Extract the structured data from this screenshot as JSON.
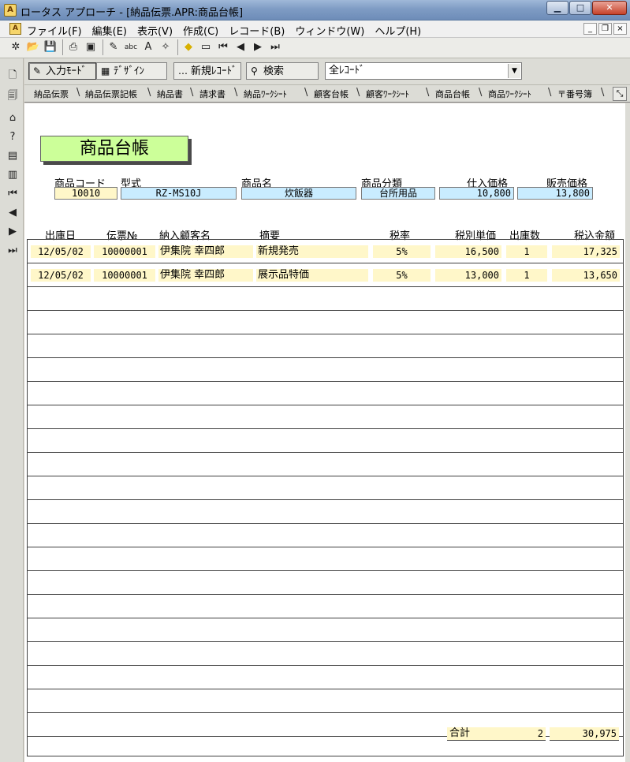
{
  "window": {
    "title": "ロータス アプローチ - [納品伝票.APR:商品台帳]",
    "app_icon": "lotus-approach-icon",
    "minimize": "▁",
    "maximize": "□",
    "close": "✕"
  },
  "menu": {
    "items": [
      {
        "label": "ファイル(F)"
      },
      {
        "label": "編集(E)"
      },
      {
        "label": "表示(V)"
      },
      {
        "label": "作成(C)"
      },
      {
        "label": "レコード(B)"
      },
      {
        "label": "ウィンドウ(W)"
      },
      {
        "label": "ヘルプ(H)"
      }
    ],
    "mdi": {
      "minimize": "_",
      "restore": "❐",
      "close": "×"
    }
  },
  "toolbar": {
    "icons": {
      "new": "✲",
      "open": "📂",
      "save": "💾",
      "print": "⎙",
      "preview": "▣",
      "edit": "✎",
      "spell": "abc",
      "text": "A",
      "wand": "✧",
      "diamond": "◆",
      "field": "▭",
      "first": "⏮",
      "prev": "◀",
      "next": "▶",
      "last": "⏭"
    }
  },
  "left_icons": {
    "form1": "🗋",
    "form2": "🗐",
    "home": "⌂",
    "help": "?",
    "report": "▤",
    "chart": "▥",
    "first": "⏮",
    "prev": "◀",
    "next": "▶",
    "last": "⏭"
  },
  "actions": {
    "input_mode": "入力ﾓｰﾄﾞ",
    "design": "ﾃﾞｻﾞｲﾝ",
    "new_record": "新規ﾚｺｰﾄﾞ",
    "search": "検索",
    "record_filter": "全ﾚｺｰﾄﾞ",
    "icons": {
      "input": "✎",
      "design": "▦",
      "new": "…",
      "search": "⚲",
      "dropdown": "▼"
    }
  },
  "tabs": [
    {
      "label": "納品伝票"
    },
    {
      "label": "納品伝票記帳"
    },
    {
      "label": "納品書"
    },
    {
      "label": "請求書"
    },
    {
      "label": "納品ﾜｰｸｼｰﾄ"
    },
    {
      "label": "顧客台帳"
    },
    {
      "label": "顧客ﾜｰｸｼｰﾄ"
    },
    {
      "label": "商品台帳"
    },
    {
      "label": "商品ﾜｰｸｼｰﾄ"
    },
    {
      "label": "〒番号簿"
    }
  ],
  "tab_separator": "\\",
  "tab_corner": "⤡",
  "form": {
    "heading": "商品台帳",
    "fields": {
      "code_label": "商品コード",
      "code": "10010",
      "model_label": "型式",
      "model": "RZ-MS10J",
      "name_label": "商品名",
      "name": "炊飯器",
      "category_label": "商品分類",
      "category": "台所用品",
      "purchase_price_label": "仕入価格",
      "purchase_price": "10,800",
      "sale_price_label": "販売価格",
      "sale_price": "13,800"
    },
    "table": {
      "headers": {
        "date": "出庫日",
        "slip_no": "伝票№",
        "customer": "納入顧客名",
        "summary": "摘要",
        "tax_rate": "税率",
        "unit_price": "税別単価",
        "qty": "出庫数",
        "amount": "税込金額"
      },
      "rows": [
        {
          "date": "12/05/02",
          "slip_no": "10000001",
          "customer": "伊集院 幸四郎",
          "summary": "新規発売",
          "tax_rate": "5%",
          "unit_price": "16,500",
          "qty": "1",
          "amount": "17,325"
        },
        {
          "date": "12/05/02",
          "slip_no": "10000001",
          "customer": "伊集院 幸四郎",
          "summary": "展示品特価",
          "tax_rate": "5%",
          "unit_price": "13,000",
          "qty": "1",
          "amount": "13,650"
        }
      ]
    },
    "total": {
      "label": "合計",
      "count": "2",
      "amount": "30,975"
    }
  }
}
